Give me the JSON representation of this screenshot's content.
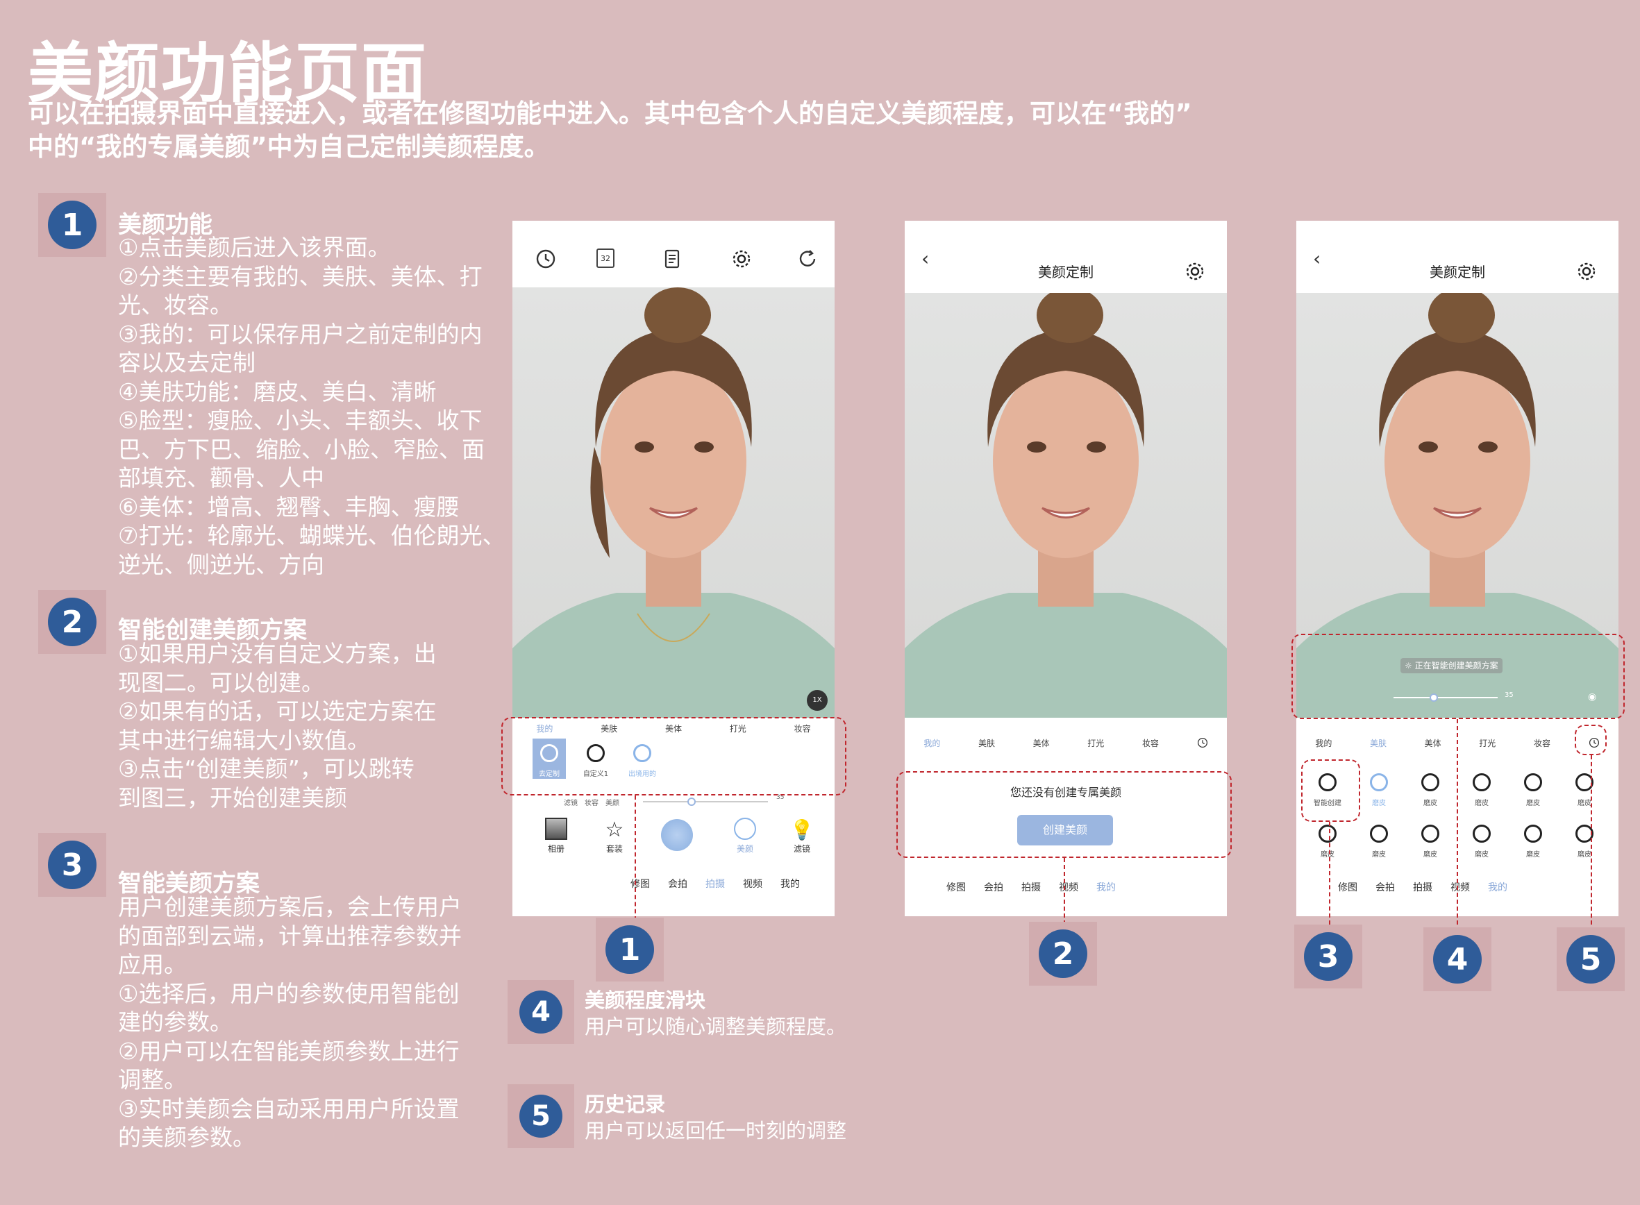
{
  "header": {
    "title": "美颜功能页面",
    "subtitle_lines": [
      "可以在拍摄界面中直接进入，或者在修图功能中进入。其中包含个人的自定义美颜程度，可以在“我的”",
      "中的“我的专属美颜”中为自己定制美颜程度。"
    ]
  },
  "sections": [
    {
      "number": "1",
      "title": "美颜功能",
      "lines": [
        "①点击美颜后进入该界面。",
        "②分类主要有我的、美肤、美体、打",
        "光、妆容。",
        "③我的：可以保存用户之前定制的内",
        "容以及去定制",
        "④美肤功能：磨皮、美白、清晰",
        "⑤脸型：瘦脸、小头、丰额头、收下",
        "巴、方下巴、缩脸、小脸、窄脸、面",
        "部填充、颧骨、人中",
        "⑥美体：增高、翘臀、丰胸、瘦腰",
        "⑦打光：轮廓光、蝴蝶光、伯伦朗光、",
        "逆光、侧逆光、方向"
      ]
    },
    {
      "number": "2",
      "title": "智能创建美颜方案",
      "lines": [
        "①如果用户没有自定义方案，出",
        "现图二。可以创建。",
        "②如果有的话，可以选定方案在",
        "其中进行编辑大小数值。",
        "③点击“创建美颜”，可以跳转",
        "到图三，开始创建美颜"
      ]
    },
    {
      "number": "3",
      "title": "智能美颜方案",
      "lines": [
        "用户创建美颜方案后，会上传用户",
        "的面部到云端，计算出推荐参数并",
        "应用。",
        "①选择后，用户的参数使用智能创",
        "建的参数。",
        "②用户可以在智能美颜参数上进行",
        "调整。",
        "③实时美颜会自动采用用户所设置",
        "的美颜参数。"
      ]
    }
  ],
  "legend": [
    {
      "number": "4",
      "title": "美颜程度滑块",
      "body": "用户可以随心调整美颜程度。"
    },
    {
      "number": "5",
      "title": "历史记录",
      "body": "用户可以返回任一时刻的调整"
    }
  ],
  "callouts": [
    "1",
    "2",
    "3",
    "4",
    "5"
  ],
  "phone1": {
    "timer_label": "32",
    "zoom_badge": "1X",
    "tabs": [
      "我的",
      "美肤",
      "美体",
      "打光",
      "妆容"
    ],
    "active_tab": "我的",
    "options": [
      "去定制",
      "自定义1",
      "出境用的"
    ],
    "slider_labels": [
      "滤镜",
      "妆容",
      "美颜"
    ],
    "slider_value": "35",
    "tools": [
      "相册",
      "套装",
      "美颜",
      "滤镜"
    ],
    "nav": [
      "修图",
      "会拍",
      "拍摄",
      "视频",
      "我的"
    ],
    "active_nav": "拍摄"
  },
  "phone2": {
    "title": "美颜定制",
    "tabs": [
      "我的",
      "美肤",
      "美体",
      "打光",
      "妆容"
    ],
    "active_tab": "我的",
    "empty_text": "您还没有创建专属美颜",
    "create_button": "创建美颜",
    "nav": [
      "修图",
      "会拍",
      "拍摄",
      "视频",
      "我的"
    ],
    "active_nav": "我的"
  },
  "phone3": {
    "title": "美颜定制",
    "status_text": "正在智能创建美颜方案",
    "slider_value": "35",
    "tabs": [
      "我的",
      "美肤",
      "美体",
      "打光",
      "妆容"
    ],
    "active_tab": "美肤",
    "options_row1": [
      "智能创建",
      "磨皮",
      "磨皮",
      "磨皮",
      "磨皮",
      "磨皮"
    ],
    "options_row2": [
      "磨皮",
      "磨皮",
      "磨皮",
      "磨皮",
      "磨皮",
      "磨皮"
    ],
    "nav": [
      "修图",
      "会拍",
      "拍摄",
      "视频",
      "我的"
    ],
    "active_nav": "我的"
  }
}
